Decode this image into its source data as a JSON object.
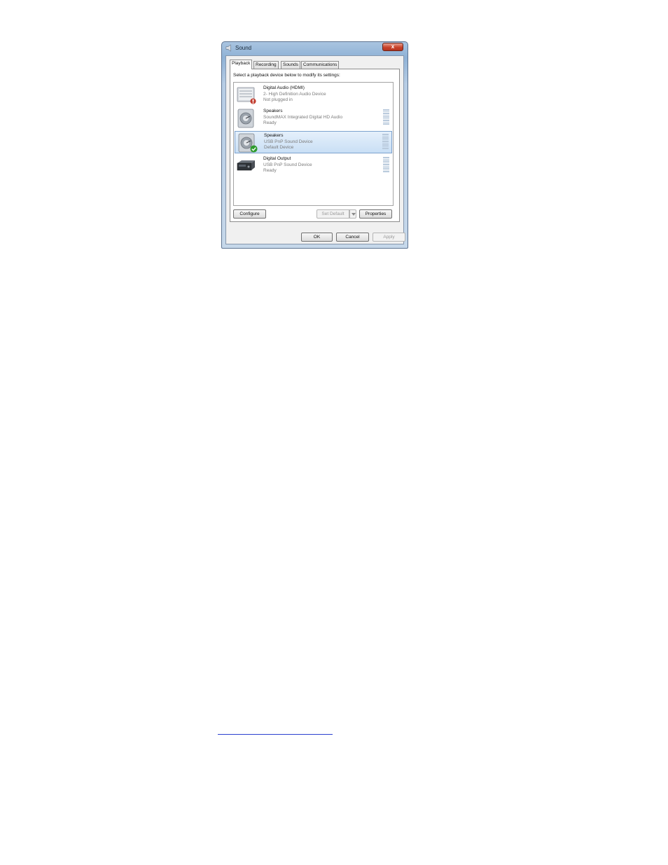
{
  "window": {
    "title": "Sound",
    "close_label": "x"
  },
  "tabs": [
    {
      "label": "Playback",
      "active": true
    },
    {
      "label": "Recording",
      "active": false
    },
    {
      "label": "Sounds",
      "active": false
    },
    {
      "label": "Communications",
      "active": false
    }
  ],
  "instruction": "Select a playback device below to modify its settings:",
  "devices": [
    {
      "name": "Digital Audio (HDMI)",
      "description": "2- High Definition Audio Device",
      "status": "Not plugged in",
      "icon": "hdmi-device-icon",
      "badge": "not-plugged-icon",
      "selected": false
    },
    {
      "name": "Speakers",
      "description": "SoundMAX Integrated Digital HD Audio",
      "status": "Ready",
      "icon": "speaker-icon",
      "badge": "",
      "selected": false
    },
    {
      "name": "Speakers",
      "description": "USB PnP Sound Device",
      "status": "Default Device",
      "icon": "speaker-icon",
      "badge": "default-check-icon",
      "selected": true
    },
    {
      "name": "Digital Output",
      "description": "USB PnP Sound Device",
      "status": "Ready",
      "icon": "digital-output-icon",
      "badge": "",
      "selected": false
    }
  ],
  "buttons": {
    "configure": "Configure",
    "set_default": "Set Default",
    "properties": "Properties",
    "ok": "OK",
    "cancel": "Cancel",
    "apply": "Apply"
  },
  "colors": {
    "selection": "#c9dff5",
    "window_frame": "#8fb2d6",
    "default_check": "#2e9b2e",
    "unplugged_badge": "#c0392b",
    "link": "#2a3fd0"
  }
}
